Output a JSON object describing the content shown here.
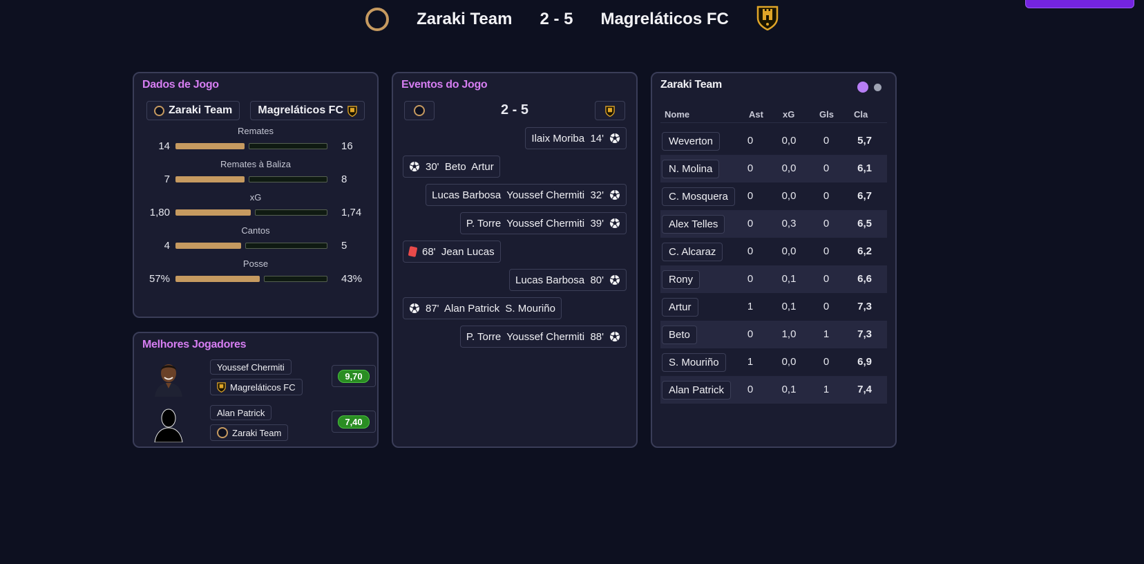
{
  "header": {
    "home_team": "Zaraki Team",
    "score": "2 - 5",
    "away_team": "Magreláticos FC"
  },
  "stats_card": {
    "title": "Dados de Jogo",
    "home_team": "Zaraki Team",
    "away_team": "Magreláticos FC",
    "stats": [
      {
        "label": "Remates",
        "home": "14",
        "away": "16",
        "home_share": 0.467
      },
      {
        "label": "Remates à Baliza",
        "home": "7",
        "away": "8",
        "home_share": 0.467
      },
      {
        "label": "xG",
        "home": "1,80",
        "away": "1,74",
        "home_share": 0.508
      },
      {
        "label": "Cantos",
        "home": "4",
        "away": "5",
        "home_share": 0.444
      },
      {
        "label": "Posse",
        "home": "57%",
        "away": "43%",
        "home_share": 0.57
      }
    ]
  },
  "best_players": {
    "title": "Melhores Jogadores",
    "players": [
      {
        "name": "Youssef Chermiti",
        "team": "Magreláticos FC",
        "rating": "9,70",
        "team_icon": "shield-crest-icon"
      },
      {
        "name": "Alan Patrick",
        "team": "Zaraki Team",
        "rating": "7,40",
        "team_icon": "ring-icon"
      }
    ]
  },
  "events_card": {
    "title": "Eventos do Jogo",
    "score": "2 - 5",
    "events": [
      {
        "side": "away",
        "text": "Ilaix Moriba  14'",
        "icon": "ball-icon"
      },
      {
        "side": "home",
        "text": "30'  Beto  Artur",
        "icon": "ball-icon"
      },
      {
        "side": "away",
        "text": "Lucas Barbosa  Youssef Chermiti  32'",
        "icon": "ball-icon"
      },
      {
        "side": "away",
        "text": "P. Torre  Youssef Chermiti  39'",
        "icon": "ball-icon"
      },
      {
        "side": "home",
        "text": "68'  Jean Lucas",
        "icon": "red-card-icon"
      },
      {
        "side": "away",
        "text": "Lucas Barbosa  80'",
        "icon": "ball-icon"
      },
      {
        "side": "home",
        "text": "87'  Alan Patrick  S. Mouriño",
        "icon": "ball-icon"
      },
      {
        "side": "away",
        "text": "P. Torre  Youssef Chermiti  88'",
        "icon": "ball-icon"
      }
    ]
  },
  "team_table": {
    "title": "Zaraki Team",
    "columns": [
      "Nome",
      "Ast",
      "xG",
      "Gls",
      "Cla"
    ],
    "rows": [
      [
        "Weverton",
        "0",
        "0,0",
        "0",
        "5,7"
      ],
      [
        "N. Molina",
        "0",
        "0,0",
        "0",
        "6,1"
      ],
      [
        "C. Mosquera",
        "0",
        "0,0",
        "0",
        "6,7"
      ],
      [
        "Alex Telles",
        "0",
        "0,3",
        "0",
        "6,5"
      ],
      [
        "C. Alcaraz",
        "0",
        "0,0",
        "0",
        "6,2"
      ],
      [
        "Rony",
        "0",
        "0,1",
        "0",
        "6,6"
      ],
      [
        "Artur",
        "1",
        "0,1",
        "0",
        "7,3"
      ],
      [
        "Beto",
        "0",
        "1,0",
        "1",
        "7,3"
      ],
      [
        "S. Mouriño",
        "1",
        "0,0",
        "0",
        "6,9"
      ],
      [
        "Alan Patrick",
        "0",
        "0,1",
        "1",
        "7,4"
      ]
    ],
    "page_dots": {
      "active_color": "#b77ef5",
      "inactive_color": "#9ea3b3"
    }
  },
  "colors": {
    "accent_title": "#d67ef2",
    "bar_fill": "#c69a60",
    "rating_green": "#2a8d23",
    "corner_button": "#7424e0"
  }
}
